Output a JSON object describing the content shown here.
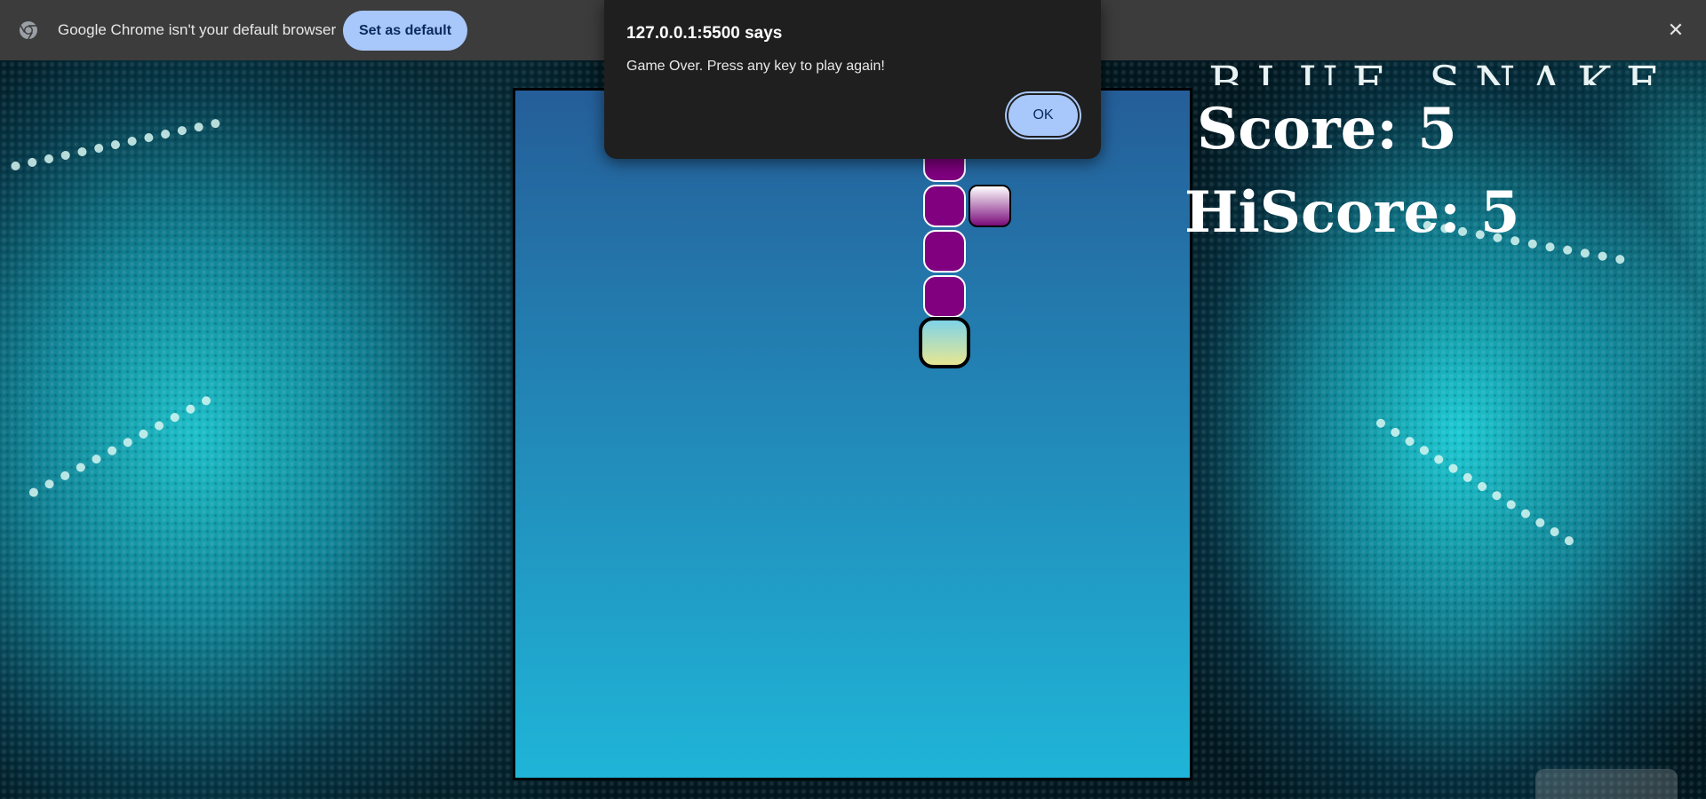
{
  "infobar": {
    "message": "Google Chrome isn't your default browser",
    "set_default_label": "Set as default",
    "close_glyph": "✕",
    "icon": "chrome-icon"
  },
  "dialog": {
    "title": "127.0.0.1:5500 says",
    "message": "Game Over. Press any key to play again!",
    "ok_label": "OK"
  },
  "game": {
    "title": "BLUE SNAKE",
    "score_text": "Score: 5",
    "hiscore_text": "HiScore: 5",
    "colors": {
      "board_top": "#255e99",
      "board_bottom": "#1fb5d8",
      "snake_body": "#800080",
      "snake_head_top": "#7fd3e8",
      "snake_head_bottom": "#e7e792",
      "food_top": "#ffffff",
      "food_bottom": "#7a0c7a"
    }
  },
  "colors": {
    "infobar_bg": "#3c3c3c",
    "button_accent": "#a8c7fa",
    "dialog_bg": "#1f1f1f"
  }
}
